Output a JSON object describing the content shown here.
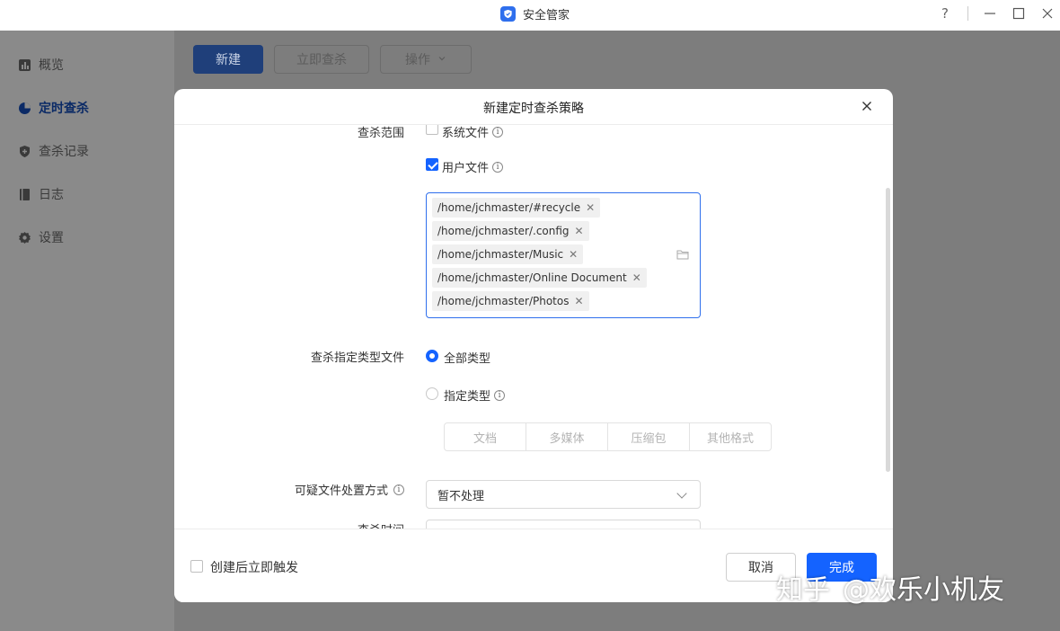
{
  "window": {
    "title": "安全管家",
    "help": "?"
  },
  "sidebar": {
    "items": [
      {
        "label": "概览",
        "icon": "chart-icon"
      },
      {
        "label": "定时查杀",
        "icon": "clock-icon",
        "active": true
      },
      {
        "label": "查杀记录",
        "icon": "shield-icon"
      },
      {
        "label": "日志",
        "icon": "book-icon"
      },
      {
        "label": "设置",
        "icon": "gear-icon"
      }
    ]
  },
  "toolbar": {
    "new_label": "新建",
    "scan_now_label": "立即查杀",
    "actions_label": "操作"
  },
  "dialog": {
    "title": "新建定时查杀策略",
    "scan_scope": {
      "label": "查杀范围",
      "system_files": {
        "label": "系统文件",
        "checked": false
      },
      "user_files": {
        "label": "用户文件",
        "checked": true
      },
      "paths": [
        "/home/jchmaster/#recycle",
        "/home/jchmaster/.config",
        "/home/jchmaster/Music",
        "/home/jchmaster/Online Document",
        "/home/jchmaster/Photos"
      ]
    },
    "file_types": {
      "label": "查杀指定类型文件",
      "all_types": {
        "label": "全部类型",
        "selected": true
      },
      "specified_types": {
        "label": "指定类型",
        "selected": false
      },
      "options": [
        "文档",
        "多媒体",
        "压缩包",
        "其他格式"
      ]
    },
    "suspicious": {
      "label": "可疑文件处置方式",
      "value": "暂不处理"
    },
    "scan_time": {
      "label": "查杀时间"
    },
    "trigger_after_create": {
      "label": "创建后立即触发",
      "checked": false
    },
    "cancel_label": "取消",
    "ok_label": "完成"
  },
  "watermark": {
    "brand": "知乎",
    "handle": "@欢乐小机友"
  },
  "colors": {
    "accent": "#1463ff",
    "overlay": "#7d7d7d"
  }
}
